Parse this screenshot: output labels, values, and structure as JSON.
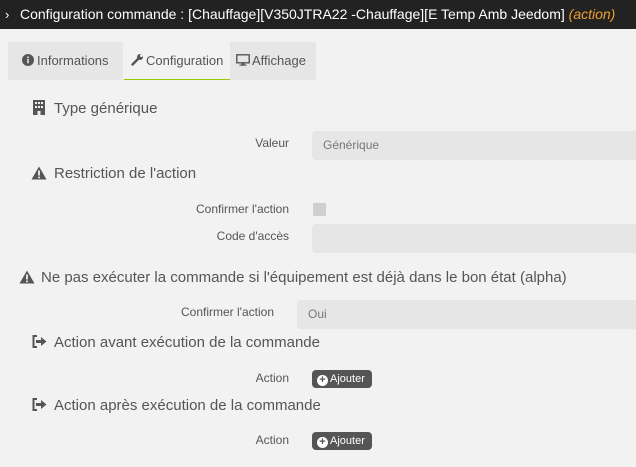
{
  "title": {
    "chevron": "›",
    "text": "Configuration commande : [Chauffage][V350JTRA22 -Chauffage][E Temp Amb Jeedom]",
    "action_tag": "(action)"
  },
  "tabs": [
    {
      "label": "Informations",
      "icon": "info-circle-icon",
      "active": false
    },
    {
      "label": "Configuration",
      "icon": "wrench-icon",
      "active": true
    },
    {
      "label": "Affichage",
      "icon": "desktop-icon",
      "active": false
    }
  ],
  "sections": {
    "generic_type": {
      "title": "Type générique",
      "icon": "building-icon"
    },
    "restriction": {
      "title": "Restriction de l'action",
      "icon": "warning-icon"
    },
    "no_execute": {
      "title": "Ne pas exécuter la commande si l'équipement est déjà dans le bon état (alpha)",
      "icon": "warning-icon"
    },
    "action_before": {
      "title": "Action avant exécution de la commande",
      "icon": "sign-out-icon"
    },
    "action_after": {
      "title": "Action après exécution de la commande",
      "icon": "sign-out-icon"
    }
  },
  "fields": {
    "valeur": {
      "label": "Valeur",
      "value": "Générique"
    },
    "confirm_action": {
      "label": "Confirmer l'action",
      "checked": false
    },
    "access_code": {
      "label": "Code d'accès",
      "value": ""
    },
    "confirm_state": {
      "label": "Confirmer l'action",
      "value": "Oui"
    },
    "action_before": {
      "label": "Action",
      "button": "Ajouter"
    },
    "action_after": {
      "label": "Action",
      "button": "Ajouter"
    }
  },
  "colors": {
    "title_bg": "#222222",
    "action_tag": "#f0a030",
    "active_tab_underline": "#94ca02",
    "button_bg": "#555555"
  }
}
